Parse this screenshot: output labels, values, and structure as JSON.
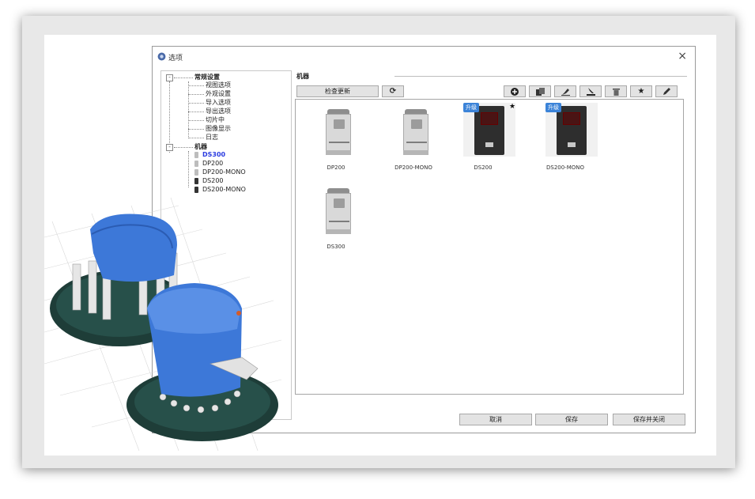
{
  "dialog": {
    "title": "选项",
    "close_label": "×"
  },
  "tree": {
    "general": {
      "label": "常规设置",
      "items": [
        "视图选项",
        "外观设置",
        "导入选项",
        "导出选项",
        "切片中",
        "图像显示",
        "日志"
      ]
    },
    "machines": {
      "label": "机器",
      "items": [
        "DS300",
        "DP200",
        "DP200-MONO",
        "DS200",
        "DS200-MONO"
      ],
      "selected": "DS300"
    },
    "expand_symbol": "-"
  },
  "panel": {
    "section_label": "机器",
    "check_update_label": "检查更新",
    "icons": [
      "refresh-icon",
      "add-icon",
      "copy-icon",
      "edit-icon",
      "import-icon",
      "delete-icon",
      "star-icon",
      "pen-icon"
    ]
  },
  "printers": [
    {
      "name": "DP200",
      "style": "white",
      "badge": "",
      "star": ""
    },
    {
      "name": "DP200-MONO",
      "style": "white",
      "badge": "",
      "star": ""
    },
    {
      "name": "DS200",
      "style": "dark",
      "badge": "升级",
      "star": "★"
    },
    {
      "name": "DS200-MONO",
      "style": "dark",
      "badge": "升级",
      "star": ""
    },
    {
      "name": "DS300",
      "style": "white",
      "badge": "",
      "star": ""
    }
  ],
  "footer": {
    "cancel_label": "取消",
    "save_label": "保存",
    "save_close_label": "保存并关闭"
  },
  "colors": {
    "selected_text": "#2a3be0",
    "badge": "#3b83d8",
    "model_blue": "#3d78d8",
    "model_dark": "#1e3d38"
  }
}
